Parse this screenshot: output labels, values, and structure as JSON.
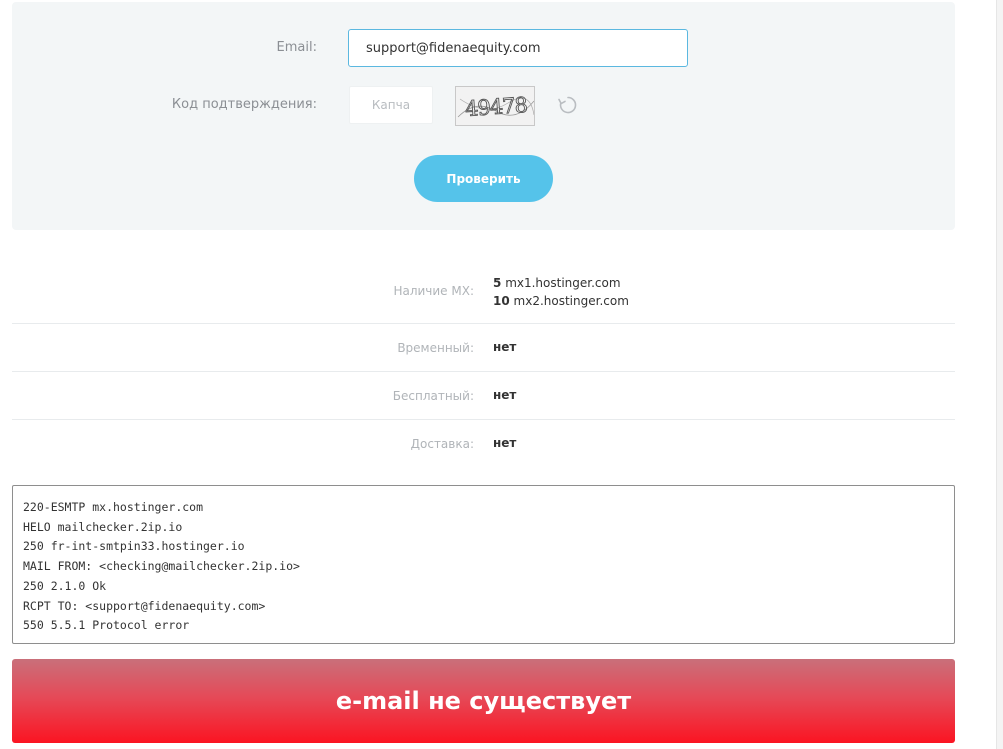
{
  "form": {
    "email_label": "Email:",
    "email_value": "support@fidenaequity.com",
    "captcha_label": "Код подтверждения:",
    "captcha_placeholder": "Капча",
    "captcha_text": "49478",
    "check_button_label": "Проверить"
  },
  "results": {
    "mx": {
      "label": "Наличие MX:",
      "records": [
        {
          "priority": "5",
          "host": "mx1.hostinger.com"
        },
        {
          "priority": "10",
          "host": "mx2.hostinger.com"
        }
      ]
    },
    "temporary": {
      "label": "Временный:",
      "value": "нет"
    },
    "free": {
      "label": "Бесплатный:",
      "value": "нет"
    },
    "delivery": {
      "label": "Доставка:",
      "value": "нет"
    }
  },
  "log": [
    "220-ESMTP mx.hostinger.com",
    "HELO mailchecker.2ip.io",
    "250 fr-int-smtpin33.hostinger.io",
    "MAIL FROM: <checking@mailchecker.2ip.io>",
    "250 2.1.0 Ok",
    "RCPT TO: <support@fidenaequity.com>",
    "550 5.5.1 Protocol error"
  ],
  "status": {
    "text": "e-mail не существует",
    "color": "#fb1422"
  },
  "colors": {
    "accent": "#55c3ea",
    "input_border": "#5bb8e0",
    "panel_bg": "#f3f6f7"
  }
}
